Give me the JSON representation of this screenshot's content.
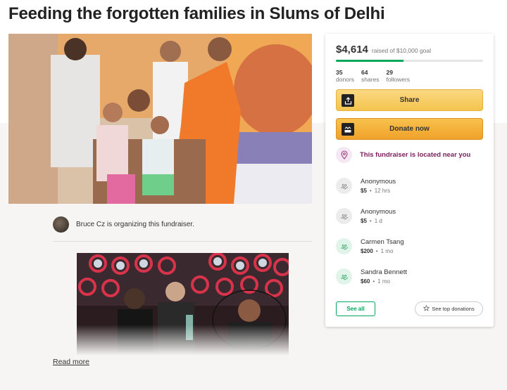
{
  "page": {
    "title": "Feeding the forgotten families in Slums of Delhi"
  },
  "organizer": {
    "text": "Bruce Cz is organizing this fundraiser."
  },
  "story": {
    "read_more": "Read more"
  },
  "fundraiser": {
    "amount_raised": "$4,614",
    "goal_text": "raised of $10,000 goal",
    "progress_fraction": 0.4614,
    "stats": [
      {
        "value": "35",
        "label": "donors"
      },
      {
        "value": "64",
        "label": "shares"
      },
      {
        "value": "29",
        "label": "followers"
      }
    ],
    "share_label": "Share",
    "donate_label": "Donate now",
    "location_text": "This fundraiser is located near you",
    "donations": [
      {
        "name": "Anonymous",
        "amount": "$5",
        "time": "12 hrs",
        "avatar": "grey"
      },
      {
        "name": "Anonymous",
        "amount": "$5",
        "time": "1 d",
        "avatar": "grey"
      },
      {
        "name": "Carmen Tsang",
        "amount": "$200",
        "time": "1 mo",
        "avatar": "green"
      },
      {
        "name": "Sandra Bennett",
        "amount": "$60",
        "time": "1 mo",
        "avatar": "green"
      }
    ],
    "see_all_label": "See all",
    "top_donations_label": "See top donations"
  },
  "colors": {
    "accent_green": "#02a95c",
    "donate_orange": "#efa12a",
    "location_purple": "#7a1c5a"
  },
  "icons": {
    "share": "share-icon",
    "donate": "donate-icon",
    "location": "location-pin-icon",
    "donor": "hand-heart-icon",
    "star": "star-icon"
  }
}
